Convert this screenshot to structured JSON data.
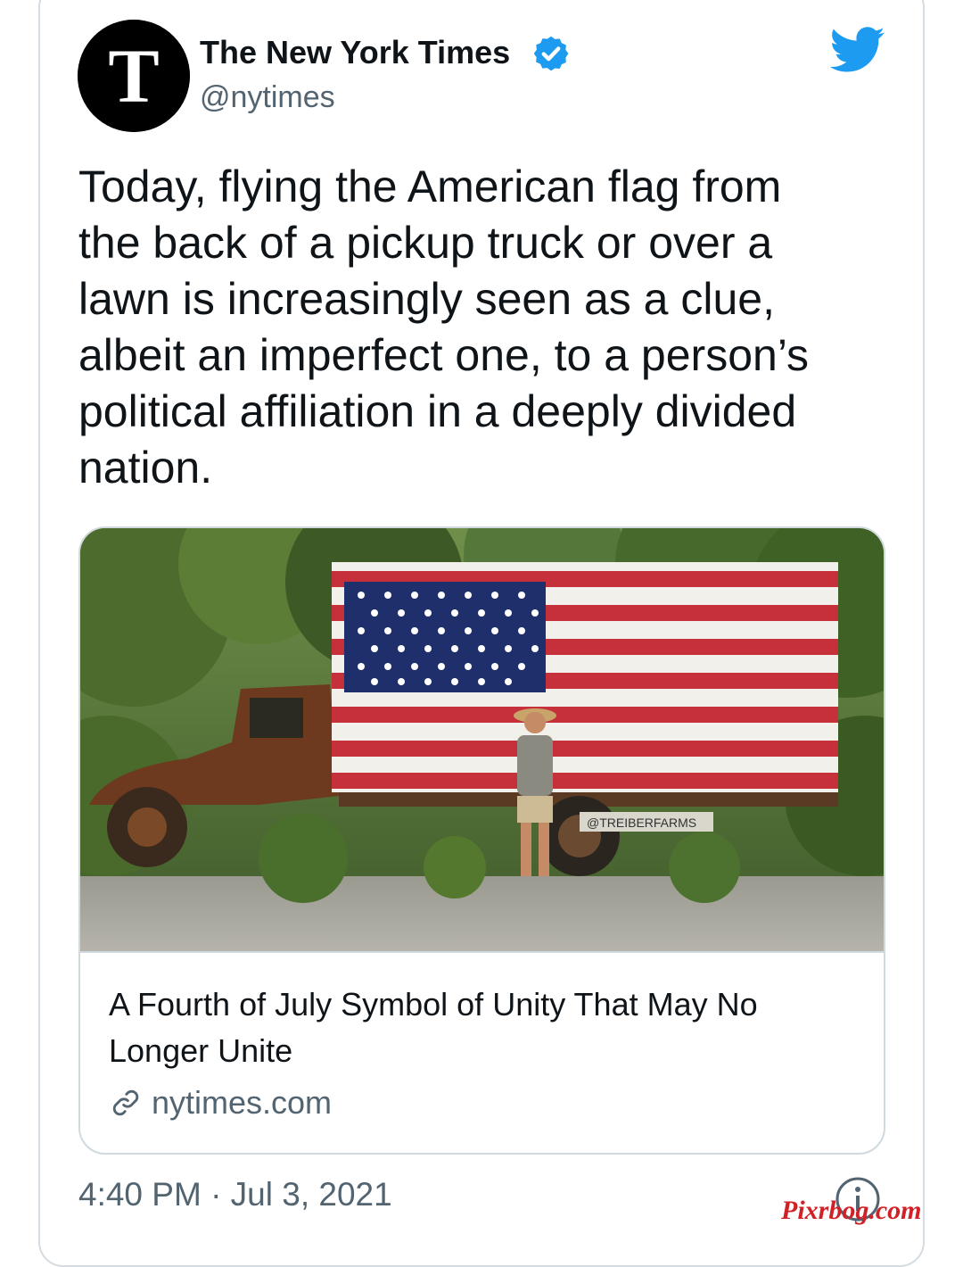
{
  "author": {
    "display_name": "The New York Times",
    "handle": "@nytimes",
    "avatar_letter": "T",
    "verified": true
  },
  "tweet": {
    "text_lines": [
      "Today, flying the American flag from",
      "the back of a pickup truck or over a",
      "lawn is increasingly seen as a clue,",
      "albeit an imperfect one, to a person’s",
      "political affiliation in a deeply divided",
      "nation."
    ]
  },
  "link_card": {
    "title_lines": [
      "A Fourth of July Symbol of Unity That May No",
      "Longer Unite"
    ],
    "domain": "nytimes.com",
    "image_caption_text": "@TREIBERFARMS"
  },
  "meta": {
    "timestamp": "4:40 PM · Jul 3, 2021"
  },
  "watermark": "Pixrbog.com",
  "colors": {
    "twitter_blue": "#1d9bf0",
    "text_primary": "#0f1419",
    "text_secondary": "#536471",
    "border": "#cfd9de"
  },
  "icons": {
    "brand": "twitter-bird-icon",
    "verified": "verified-badge-icon",
    "link": "link-icon",
    "info": "info-icon"
  }
}
